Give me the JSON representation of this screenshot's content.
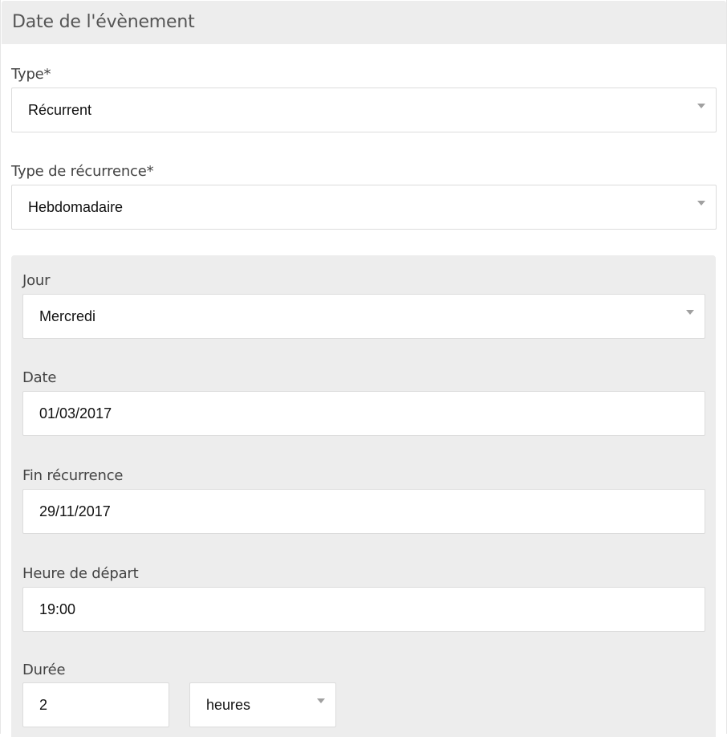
{
  "panel": {
    "title": "Date de l'évènement"
  },
  "type": {
    "label": "Type*",
    "value": "Récurrent",
    "caret_icon": "dropdown-caret-icon"
  },
  "recurrence_type": {
    "label": "Type de récurrence*",
    "value": "Hebdomadaire",
    "caret_icon": "dropdown-caret-icon"
  },
  "day": {
    "label": "Jour",
    "value": "Mercredi",
    "caret_icon": "dropdown-caret-icon"
  },
  "date": {
    "label": "Date",
    "value": "01/03/2017"
  },
  "recurrence_end": {
    "label": "Fin récurrence",
    "value": "29/11/2017"
  },
  "start_time": {
    "label": "Heure de départ",
    "value": "19:00"
  },
  "duration": {
    "label": "Durée",
    "value": "2",
    "unit": "heures",
    "caret_icon": "dropdown-caret-icon"
  },
  "colors": {
    "header_bg": "#ededed",
    "subpanel_bg": "#ededed",
    "field_border": "#dcdcdc",
    "caret": "#a0a0a0"
  }
}
